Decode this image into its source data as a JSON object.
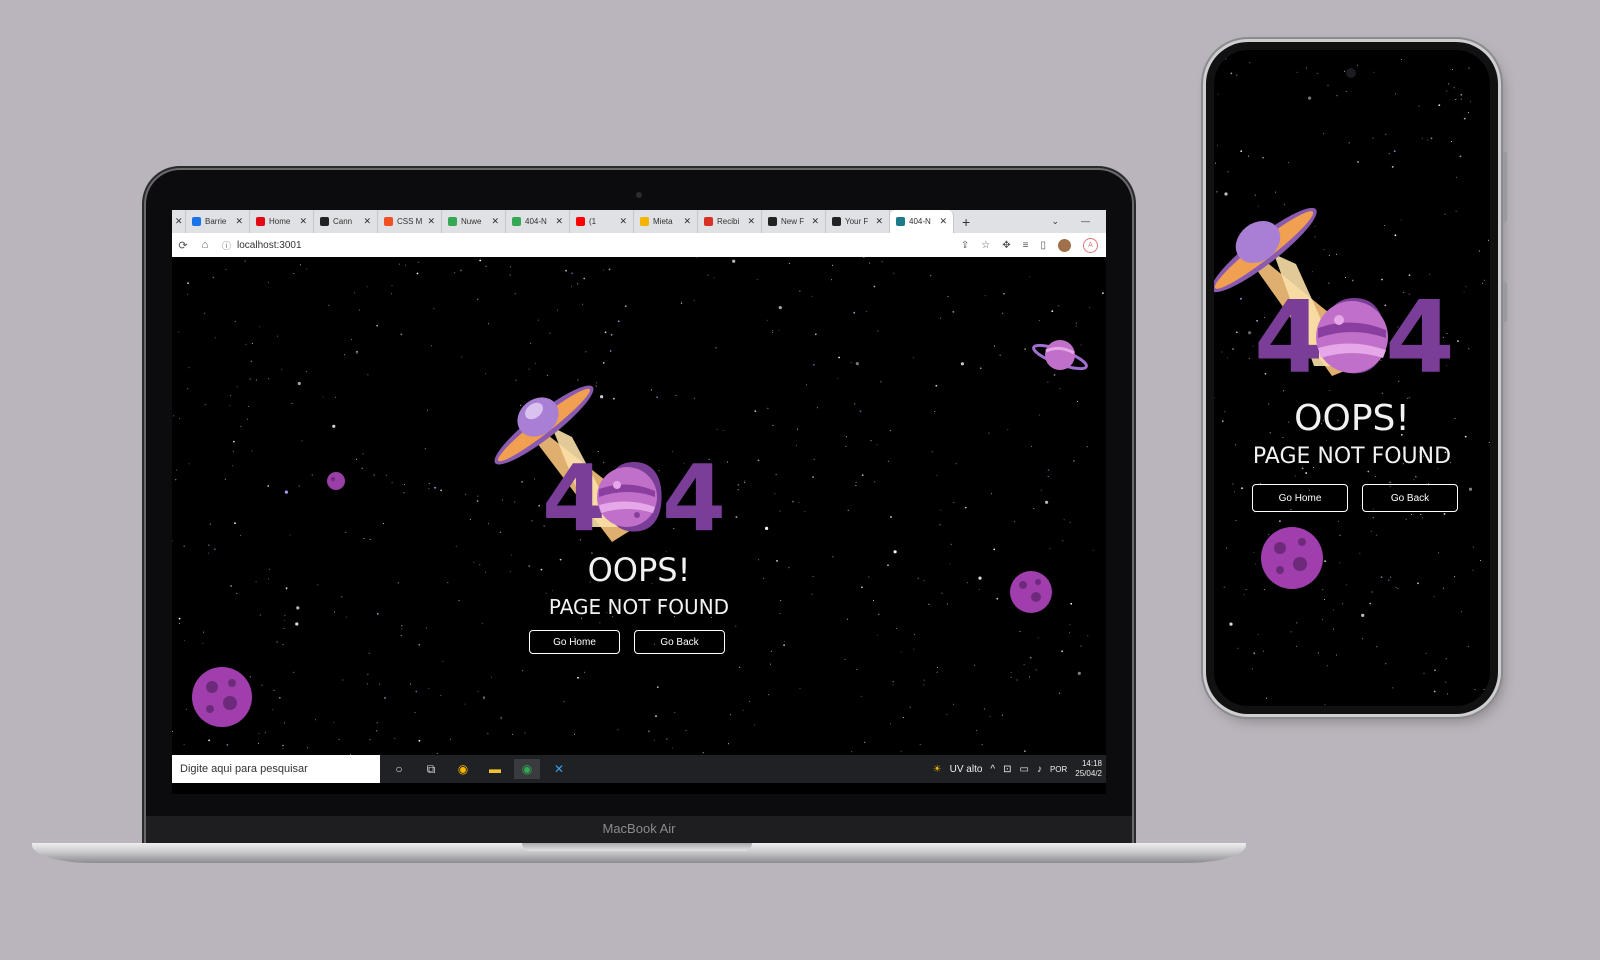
{
  "laptop": {
    "model_label": "MacBook Air"
  },
  "browser": {
    "tabs": [
      {
        "label": "Barrie",
        "icon": "site-icon",
        "color": "#1a73e8"
      },
      {
        "label": "Home",
        "icon": "netflix-icon",
        "color": "#e50914"
      },
      {
        "label": "Cann",
        "icon": "amazon-icon",
        "color": "#222222"
      },
      {
        "label": "CSS M",
        "icon": "microsoft-icon",
        "color": "#f25022"
      },
      {
        "label": "Nuwe",
        "icon": "play-icon",
        "color": "#34a853"
      },
      {
        "label": "404-N",
        "icon": "play-icon",
        "color": "#34a853"
      },
      {
        "label": "(1",
        "icon": "youtube-icon",
        "color": "#ff0000"
      },
      {
        "label": "Mieta",
        "icon": "smile-icon",
        "color": "#f4b400"
      },
      {
        "label": "Recibi",
        "icon": "gmail-icon",
        "color": "#d93025"
      },
      {
        "label": "New F",
        "icon": "github-icon",
        "color": "#222222"
      },
      {
        "label": "Your F",
        "icon": "github-icon",
        "color": "#222222"
      },
      {
        "label": "404-N",
        "icon": "react-icon",
        "color": "#1c7a8a",
        "active": true
      }
    ],
    "url": "localhost:3001"
  },
  "page": {
    "code": "404",
    "headline": "OOPS!",
    "subheadline": "PAGE NOT FOUND",
    "go_home_label": "Go Home",
    "go_back_label": "Go Back"
  },
  "taskbar": {
    "search_placeholder": "Digite aqui para pesquisar",
    "weather": "UV alto",
    "language": "POR",
    "time": "14:18",
    "date": "25/04/2"
  },
  "colors": {
    "accent_purple": "#7a3d98",
    "planet_pink": "#c070c8",
    "ufo_orange": "#f0a050",
    "background": "#000000"
  }
}
